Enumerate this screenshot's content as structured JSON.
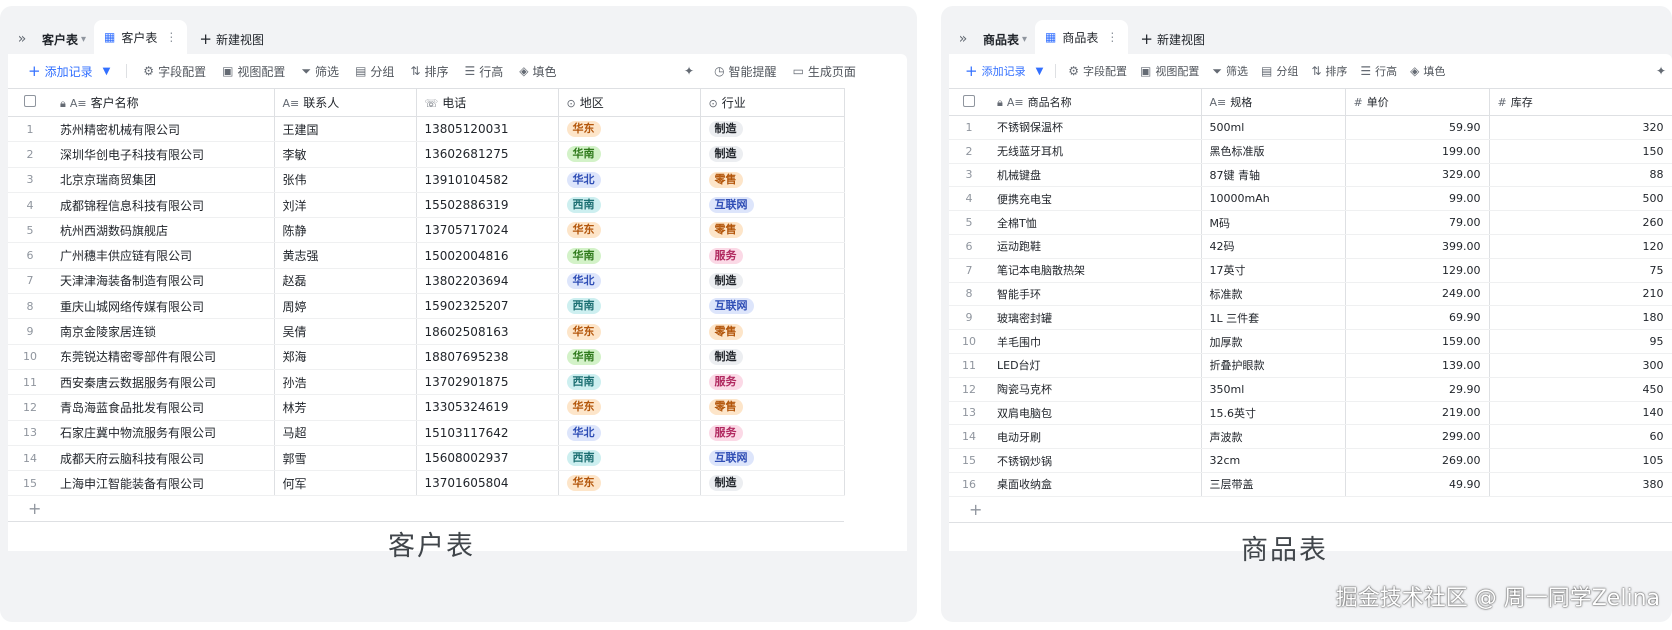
{
  "left": {
    "table_name": "客户表",
    "view_name": "客户表",
    "new_view": "新建视图",
    "toolbar": [
      "字段配置",
      "视图配置",
      "筛选",
      "分组",
      "排序",
      "行高",
      "填色"
    ],
    "add_record": "添加记录",
    "smart_remind": "智能提醒",
    "gen_page": "生成页面",
    "headers": [
      "客户名称",
      "联系人",
      "电话",
      "地区",
      "行业"
    ],
    "rows": [
      {
        "n": "1",
        "name": "苏州精密机械有限公司",
        "contact": "王建国",
        "phone": "13805120031",
        "region": "华东",
        "industry": "制造"
      },
      {
        "n": "2",
        "name": "深圳华创电子科技有限公司",
        "contact": "李敏",
        "phone": "13602681275",
        "region": "华南",
        "industry": "制造"
      },
      {
        "n": "3",
        "name": "北京京瑞商贸集团",
        "contact": "张伟",
        "phone": "13910104582",
        "region": "华北",
        "industry": "零售"
      },
      {
        "n": "4",
        "name": "成都锦程信息科技有限公司",
        "contact": "刘洋",
        "phone": "15502886319",
        "region": "西南",
        "industry": "互联网"
      },
      {
        "n": "5",
        "name": "杭州西湖数码旗舰店",
        "contact": "陈静",
        "phone": "13705717024",
        "region": "华东",
        "industry": "零售"
      },
      {
        "n": "6",
        "name": "广州穗丰供应链有限公司",
        "contact": "黄志强",
        "phone": "15002004816",
        "region": "华南",
        "industry": "服务"
      },
      {
        "n": "7",
        "name": "天津津海装备制造有限公司",
        "contact": "赵磊",
        "phone": "13802203694",
        "region": "华北",
        "industry": "制造"
      },
      {
        "n": "8",
        "name": "重庆山城网络传媒有限公司",
        "contact": "周婷",
        "phone": "15902325207",
        "region": "西南",
        "industry": "互联网"
      },
      {
        "n": "9",
        "name": "南京金陵家居连锁",
        "contact": "吴倩",
        "phone": "18602508163",
        "region": "华东",
        "industry": "零售"
      },
      {
        "n": "10",
        "name": "东莞锐达精密零部件有限公司",
        "contact": "郑海",
        "phone": "18807695238",
        "region": "华南",
        "industry": "制造"
      },
      {
        "n": "11",
        "name": "西安秦唐云数据服务有限公司",
        "contact": "孙浩",
        "phone": "13702901875",
        "region": "西南",
        "industry": "服务"
      },
      {
        "n": "12",
        "name": "青岛海蓝食品批发有限公司",
        "contact": "林芳",
        "phone": "13305324619",
        "region": "华东",
        "industry": "零售"
      },
      {
        "n": "13",
        "name": "石家庄冀中物流服务有限公司",
        "contact": "马超",
        "phone": "15103117642",
        "region": "华北",
        "industry": "服务"
      },
      {
        "n": "14",
        "name": "成都天府云脑科技有限公司",
        "contact": "郭雪",
        "phone": "15608002937",
        "region": "西南",
        "industry": "互联网"
      },
      {
        "n": "15",
        "name": "上海申江智能装备有限公司",
        "contact": "何军",
        "phone": "13701605804",
        "region": "华东",
        "industry": "制造"
      }
    ],
    "caption": "客户表"
  },
  "right": {
    "table_name": "商品表",
    "view_name": "商品表",
    "new_view": "新建视图",
    "toolbar": [
      "字段配置",
      "视图配置",
      "筛选",
      "分组",
      "排序",
      "行高",
      "填色"
    ],
    "add_record": "添加记录",
    "headers": [
      "商品名称",
      "规格",
      "单价",
      "库存"
    ],
    "rows": [
      {
        "n": "1",
        "name": "不锈钢保温杯",
        "spec": "500ml",
        "price": "59.90",
        "stock": "320"
      },
      {
        "n": "2",
        "name": "无线蓝牙耳机",
        "spec": "黑色标准版",
        "price": "199.00",
        "stock": "150"
      },
      {
        "n": "3",
        "name": "机械键盘",
        "spec": "87键 青轴",
        "price": "329.00",
        "stock": "88"
      },
      {
        "n": "4",
        "name": "便携充电宝",
        "spec": "10000mAh",
        "price": "99.00",
        "stock": "500"
      },
      {
        "n": "5",
        "name": "全棉T恤",
        "spec": "M码",
        "price": "79.00",
        "stock": "260"
      },
      {
        "n": "6",
        "name": "运动跑鞋",
        "spec": "42码",
        "price": "399.00",
        "stock": "120"
      },
      {
        "n": "7",
        "name": "笔记本电脑散热架",
        "spec": "17英寸",
        "price": "129.00",
        "stock": "75"
      },
      {
        "n": "8",
        "name": "智能手环",
        "spec": "标准款",
        "price": "249.00",
        "stock": "210"
      },
      {
        "n": "9",
        "name": "玻璃密封罐",
        "spec": "1L 三件套",
        "price": "69.90",
        "stock": "180"
      },
      {
        "n": "10",
        "name": "羊毛围巾",
        "spec": "加厚款",
        "price": "159.00",
        "stock": "95"
      },
      {
        "n": "11",
        "name": "LED台灯",
        "spec": "折叠护眼款",
        "price": "139.00",
        "stock": "300"
      },
      {
        "n": "12",
        "name": "陶瓷马克杯",
        "spec": "350ml",
        "price": "29.90",
        "stock": "450"
      },
      {
        "n": "13",
        "name": "双肩电脑包",
        "spec": "15.6英寸",
        "price": "219.00",
        "stock": "140"
      },
      {
        "n": "14",
        "name": "电动牙刷",
        "spec": "声波款",
        "price": "299.00",
        "stock": "60"
      },
      {
        "n": "15",
        "name": "不锈钢炒锅",
        "spec": "32cm",
        "price": "269.00",
        "stock": "105"
      },
      {
        "n": "16",
        "name": "桌面收纳盒",
        "spec": "三层带盖",
        "price": "49.90",
        "stock": "380"
      }
    ],
    "caption": "商品表"
  },
  "colors": {
    "accent": "#3370ff",
    "region": {
      "华东": {
        "bg": "#fde5c9",
        "fg": "#b3560b"
      },
      "华南": {
        "bg": "#d3f2c8",
        "fg": "#2f7a1c"
      },
      "华北": {
        "bg": "#dde5fb",
        "fg": "#2e4db5"
      },
      "西南": {
        "bg": "#cdeff0",
        "fg": "#1c6f72"
      }
    },
    "industry": {
      "制造": {
        "bg": "#eceef1",
        "fg": "#1f2329"
      },
      "零售": {
        "bg": "#fde5c9",
        "fg": "#b3560b"
      },
      "互联网": {
        "bg": "#dde5fb",
        "fg": "#2e4db5"
      },
      "服务": {
        "bg": "#fbd9e6",
        "fg": "#b0285f"
      }
    }
  },
  "watermark": "掘金技术社区 @ 周一同学Zelina"
}
